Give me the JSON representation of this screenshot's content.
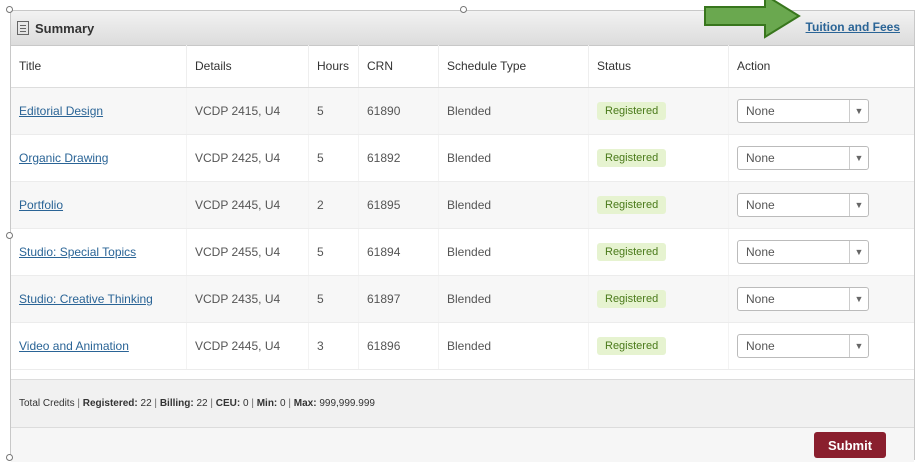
{
  "header": {
    "title": "Summary",
    "tuition_link": "Tuition and Fees"
  },
  "table": {
    "columns": [
      "Title",
      "Details",
      "Hours",
      "CRN",
      "Schedule Type",
      "Status",
      "Action"
    ],
    "rows": [
      {
        "title": "Editorial Design",
        "details": "VCDP 2415, U4",
        "hours": "5",
        "crn": "61890",
        "schedule_type": "Blended",
        "status": "Registered",
        "action": "None"
      },
      {
        "title": "Organic Drawing",
        "details": "VCDP 2425, U4",
        "hours": "5",
        "crn": "61892",
        "schedule_type": "Blended",
        "status": "Registered",
        "action": "None"
      },
      {
        "title": "Portfolio",
        "details": "VCDP 2445, U4",
        "hours": "2",
        "crn": "61895",
        "schedule_type": "Blended",
        "status": "Registered",
        "action": "None"
      },
      {
        "title": "Studio: Special Topics",
        "details": "VCDP 2455, U4",
        "hours": "5",
        "crn": "61894",
        "schedule_type": "Blended",
        "status": "Registered",
        "action": "None"
      },
      {
        "title": "Studio: Creative Thinking",
        "details": "VCDP 2435, U4",
        "hours": "5",
        "crn": "61897",
        "schedule_type": "Blended",
        "status": "Registered",
        "action": "None"
      },
      {
        "title": "Video and Animation",
        "details": "VCDP 2445, U4",
        "hours": "3",
        "crn": "61896",
        "schedule_type": "Blended",
        "status": "Registered",
        "action": "None"
      }
    ]
  },
  "summary": {
    "total_credits_label": "Total Credits",
    "registered_label": "Registered:",
    "registered": "22",
    "billing_label": "Billing:",
    "billing": "22",
    "ceu_label": "CEU:",
    "ceu": "0",
    "min_label": "Min:",
    "min": "0",
    "max_label": "Max:",
    "max": "999,999.999"
  },
  "footer": {
    "submit_label": "Submit"
  },
  "colors": {
    "link": "#2a6496",
    "submit": "#8a1f2e",
    "arrow": "#6aa84f",
    "status_bg": "#e6f3d0"
  },
  "icons": {
    "summary": "table-icon",
    "arrow": "arrow-right-icon",
    "caret": "chevron-down-icon"
  }
}
